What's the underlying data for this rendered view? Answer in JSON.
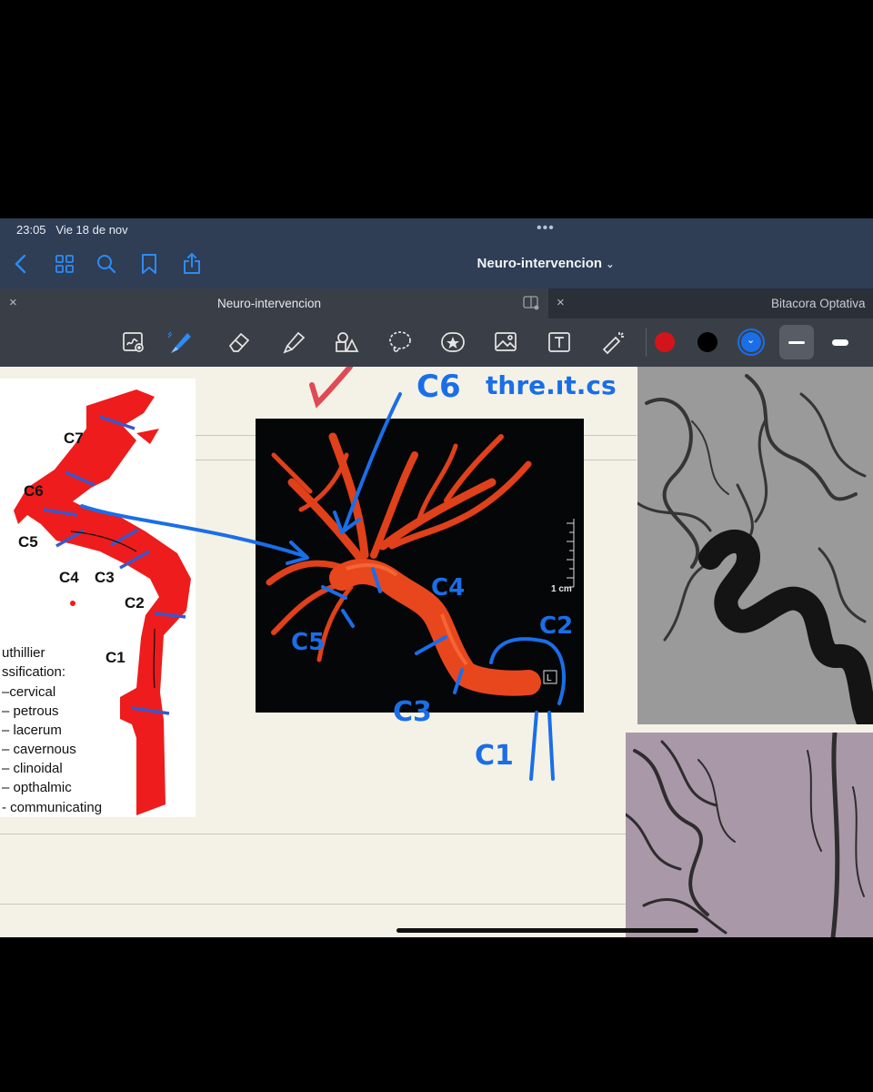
{
  "status": {
    "time": "23:05",
    "date": "Vie 18 de nov",
    "more": "•••"
  },
  "nav": {
    "title": "Neuro-intervencion",
    "icons": [
      "back-chevron-icon",
      "grid-icon",
      "search-icon",
      "bookmark-icon",
      "share-icon"
    ]
  },
  "tabs": [
    {
      "label": "Neuro-intervencion",
      "close": "×",
      "active": true
    },
    {
      "label": "Bitacora Optativa",
      "close": "×",
      "active": false
    }
  ],
  "toolbar": {
    "tools": [
      "zoom-window-icon",
      "pen-icon",
      "eraser-icon",
      "highlighter-icon",
      "shapes-icon",
      "lasso-icon",
      "sticker-icon",
      "image-icon",
      "text-box-icon",
      "laser-pointer-icon"
    ],
    "colors": [
      "#d4141b",
      "#000000",
      "#1a6ee8"
    ],
    "selected_color": "#1a6ee8",
    "stroke_sizes": [
      "thin",
      "thick"
    ],
    "selected_stroke": "thin"
  },
  "diagram": {
    "segments": [
      "C7",
      "C6",
      "C5",
      "C4",
      "C3",
      "C2",
      "C1"
    ],
    "classification_lines": [
      "uthillier",
      "ssification:",
      "–cervical",
      "– petrous",
      "– lacerum",
      "– cavernous",
      "– clinoidal",
      "– opthalmic",
      "- communicating"
    ]
  },
  "photo": {
    "scale_label": "1 cm",
    "orientation_label": "L"
  },
  "annotations": {
    "c6": "C6",
    "c6_note": "thre.ıt.cs",
    "c4": "C4",
    "c5": "C5",
    "c3": "C3",
    "c2": "C2",
    "c1": "C1"
  }
}
